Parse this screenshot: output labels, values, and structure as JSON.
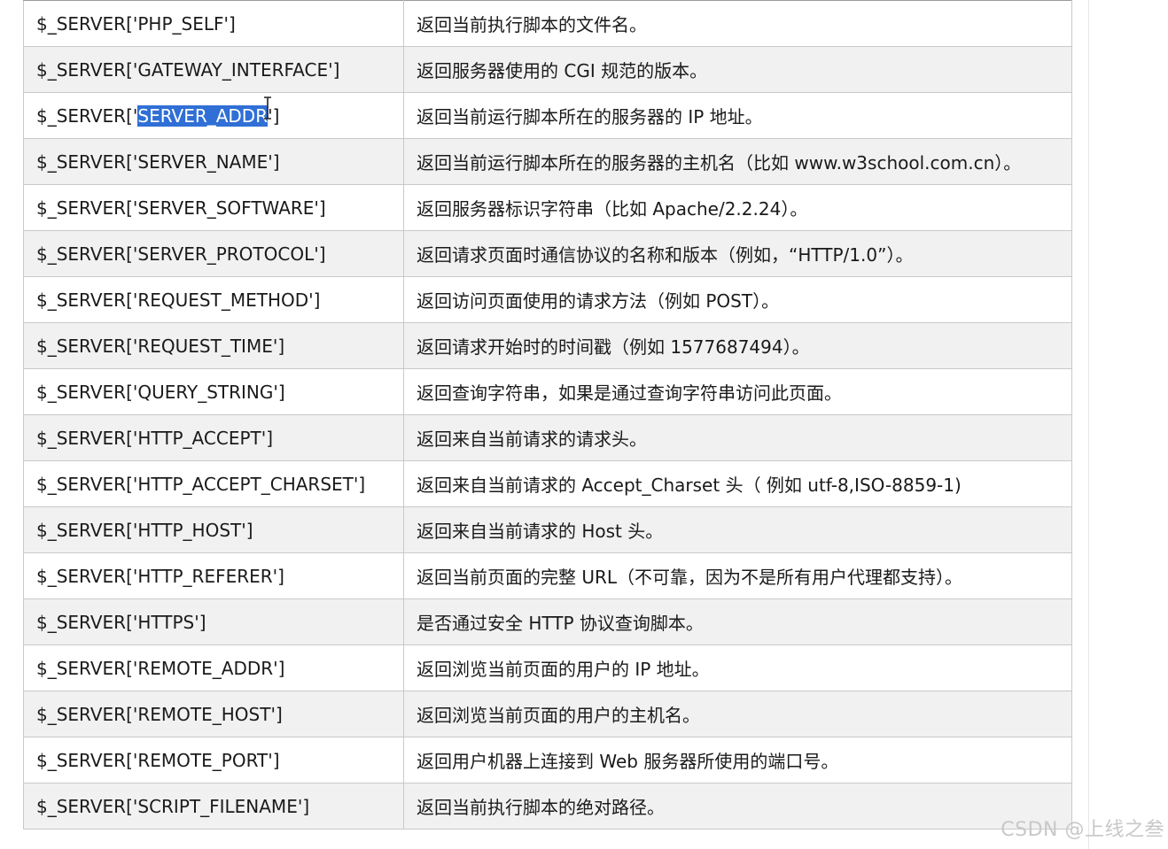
{
  "rows": [
    {
      "key": "$_SERVER['PHP_SELF']",
      "desc": "返回当前执行脚本的文件名。"
    },
    {
      "key": "$_SERVER['GATEWAY_INTERFACE']",
      "desc": "返回服务器使用的 CGI 规范的版本。"
    },
    {
      "key_prefix": "$_SERVER['",
      "key_selected": "SERVER_ADDR",
      "key_suffix": "']",
      "desc": "返回当前运行脚本所在的服务器的 IP 地址。"
    },
    {
      "key": "$_SERVER['SERVER_NAME']",
      "desc": "返回当前运行脚本所在的服务器的主机名（比如 www.w3school.com.cn）。"
    },
    {
      "key": "$_SERVER['SERVER_SOFTWARE']",
      "desc": "返回服务器标识字符串（比如 Apache/2.2.24）。"
    },
    {
      "key": "$_SERVER['SERVER_PROTOCOL']",
      "desc": "返回请求页面时通信协议的名称和版本（例如，“HTTP/1.0”）。"
    },
    {
      "key": "$_SERVER['REQUEST_METHOD']",
      "desc": "返回访问页面使用的请求方法（例如 POST）。"
    },
    {
      "key": "$_SERVER['REQUEST_TIME']",
      "desc": "返回请求开始时的时间戳（例如 1577687494）。"
    },
    {
      "key": "$_SERVER['QUERY_STRING']",
      "desc": "返回查询字符串，如果是通过查询字符串访问此页面。"
    },
    {
      "key": "$_SERVER['HTTP_ACCEPT']",
      "desc": "返回来自当前请求的请求头。"
    },
    {
      "key": "$_SERVER['HTTP_ACCEPT_CHARSET']",
      "desc": "返回来自当前请求的 Accept_Charset 头（ 例如 utf-8,ISO-8859-1)"
    },
    {
      "key": "$_SERVER['HTTP_HOST']",
      "desc": "返回来自当前请求的 Host 头。"
    },
    {
      "key": "$_SERVER['HTTP_REFERER']",
      "desc": "返回当前页面的完整 URL（不可靠，因为不是所有用户代理都支持）。"
    },
    {
      "key": "$_SERVER['HTTPS']",
      "desc": "是否通过安全 HTTP 协议查询脚本。"
    },
    {
      "key": "$_SERVER['REMOTE_ADDR']",
      "desc": "返回浏览当前页面的用户的 IP 地址。"
    },
    {
      "key": "$_SERVER['REMOTE_HOST']",
      "desc": "返回浏览当前页面的用户的主机名。"
    },
    {
      "key": "$_SERVER['REMOTE_PORT']",
      "desc": "返回用户机器上连接到 Web 服务器所使用的端口号。"
    },
    {
      "key": "$_SERVER['SCRIPT_FILENAME']",
      "desc": "返回当前执行脚本的绝对路径。"
    }
  ],
  "watermark": "CSDN @上线之叁",
  "colors": {
    "selection": "#2f6fd6",
    "row_alt": "#f1f1f1",
    "border": "#c9c9c9"
  },
  "icons": {
    "cursor": "text-cursor-icon"
  }
}
